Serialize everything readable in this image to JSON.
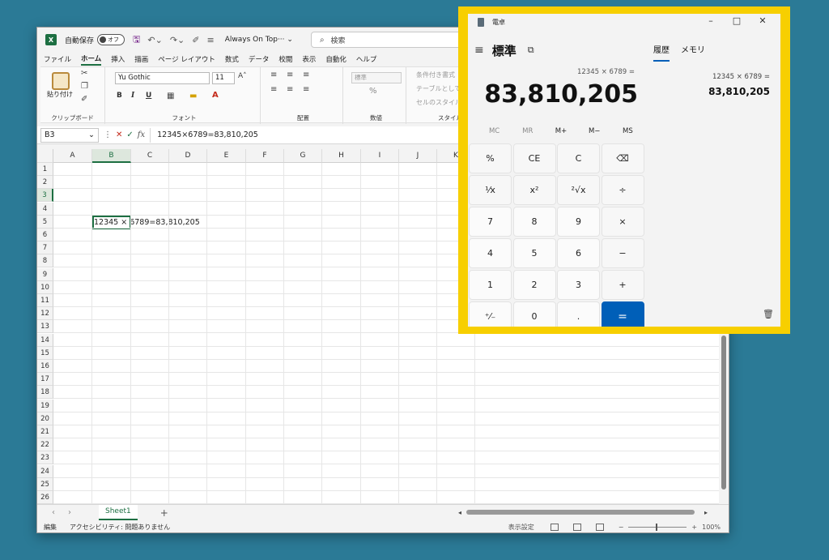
{
  "excel": {
    "autosave_label": "自動保存",
    "autosave_state": "オフ",
    "doc_title": "Always On Top··· ⌄",
    "search_placeholder": "検索",
    "menu": [
      "ファイル",
      "ホーム",
      "挿入",
      "描画",
      "ページ レイアウト",
      "数式",
      "データ",
      "校閲",
      "表示",
      "自動化",
      "ヘルプ"
    ],
    "ribbon": {
      "paste_label": "貼り付け",
      "clipboard_group": "クリップボード",
      "font_name": "Yu Gothic",
      "font_size": "11",
      "bold": "B",
      "italic": "I",
      "underline": "U",
      "font_group": "フォント",
      "align_group": "配置",
      "number_format": "標準",
      "number_group": "数値",
      "cond_format": "条件付き書式",
      "table_format": "テーブルとして書",
      "cell_style": "セルのスタイル",
      "style_group": "スタイル"
    },
    "namebox": "B3",
    "formula": "12345×6789=83,810,205",
    "columns": [
      "A",
      "B",
      "C",
      "D",
      "E",
      "F",
      "G",
      "H",
      "I",
      "J",
      "K"
    ],
    "selected_col": "B",
    "rows": [
      "1",
      "2",
      "3",
      "4",
      "5",
      "6",
      "7",
      "8",
      "9",
      "10",
      "11",
      "12",
      "13",
      "14",
      "15",
      "16",
      "17",
      "18",
      "19",
      "20",
      "21",
      "22",
      "23",
      "24",
      "25",
      "26"
    ],
    "selected_row": "3",
    "cell_b3": "12345 × 6789=83,810,205",
    "sheet_tab": "Sheet1",
    "status_mode": "編集",
    "accessibility": "アクセシビリティ: 問題ありません",
    "display_settings": "表示設定",
    "zoom": "100%"
  },
  "calc": {
    "title": "電卓",
    "mode": "標準",
    "tab_history": "履歴",
    "tab_memory": "メモリ",
    "expression": "12345 × 6789 =",
    "result": "83,810,205",
    "history_expression": "12345 × 6789 =",
    "history_result": "83,810,205",
    "memory": [
      "MC",
      "MR",
      "M+",
      "M−",
      "MS"
    ],
    "keys": [
      [
        "%",
        "CE",
        "C",
        "⌫"
      ],
      [
        "¹⁄x",
        "x²",
        "²√x",
        "÷"
      ],
      [
        "7",
        "8",
        "9",
        "×"
      ],
      [
        "4",
        "5",
        "6",
        "−"
      ],
      [
        "1",
        "2",
        "3",
        "+"
      ],
      [
        "⁺⁄₋",
        "0",
        ".",
        "="
      ]
    ],
    "accent": "#005fb8",
    "frame_color": "#f7cf00"
  }
}
